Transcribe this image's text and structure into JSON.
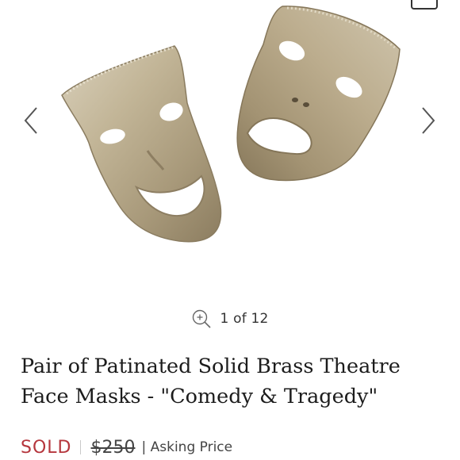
{
  "gallery": {
    "image_icon": "comedy-tragedy-masks-photo",
    "prev_icon": "chevron-left-icon",
    "next_icon": "chevron-right-icon",
    "zoom_icon": "zoom-in-icon",
    "counter": "1 of 12",
    "current": 1,
    "total": 12
  },
  "product": {
    "title": "Pair of Patinated Solid Brass Theatre Face Masks - \"Comedy & Tragedy\"",
    "status": "SOLD",
    "original_price": "$250",
    "price_note": "| Asking Price"
  },
  "colors": {
    "sold": "#b5363d",
    "brass": "#b8a98a"
  }
}
